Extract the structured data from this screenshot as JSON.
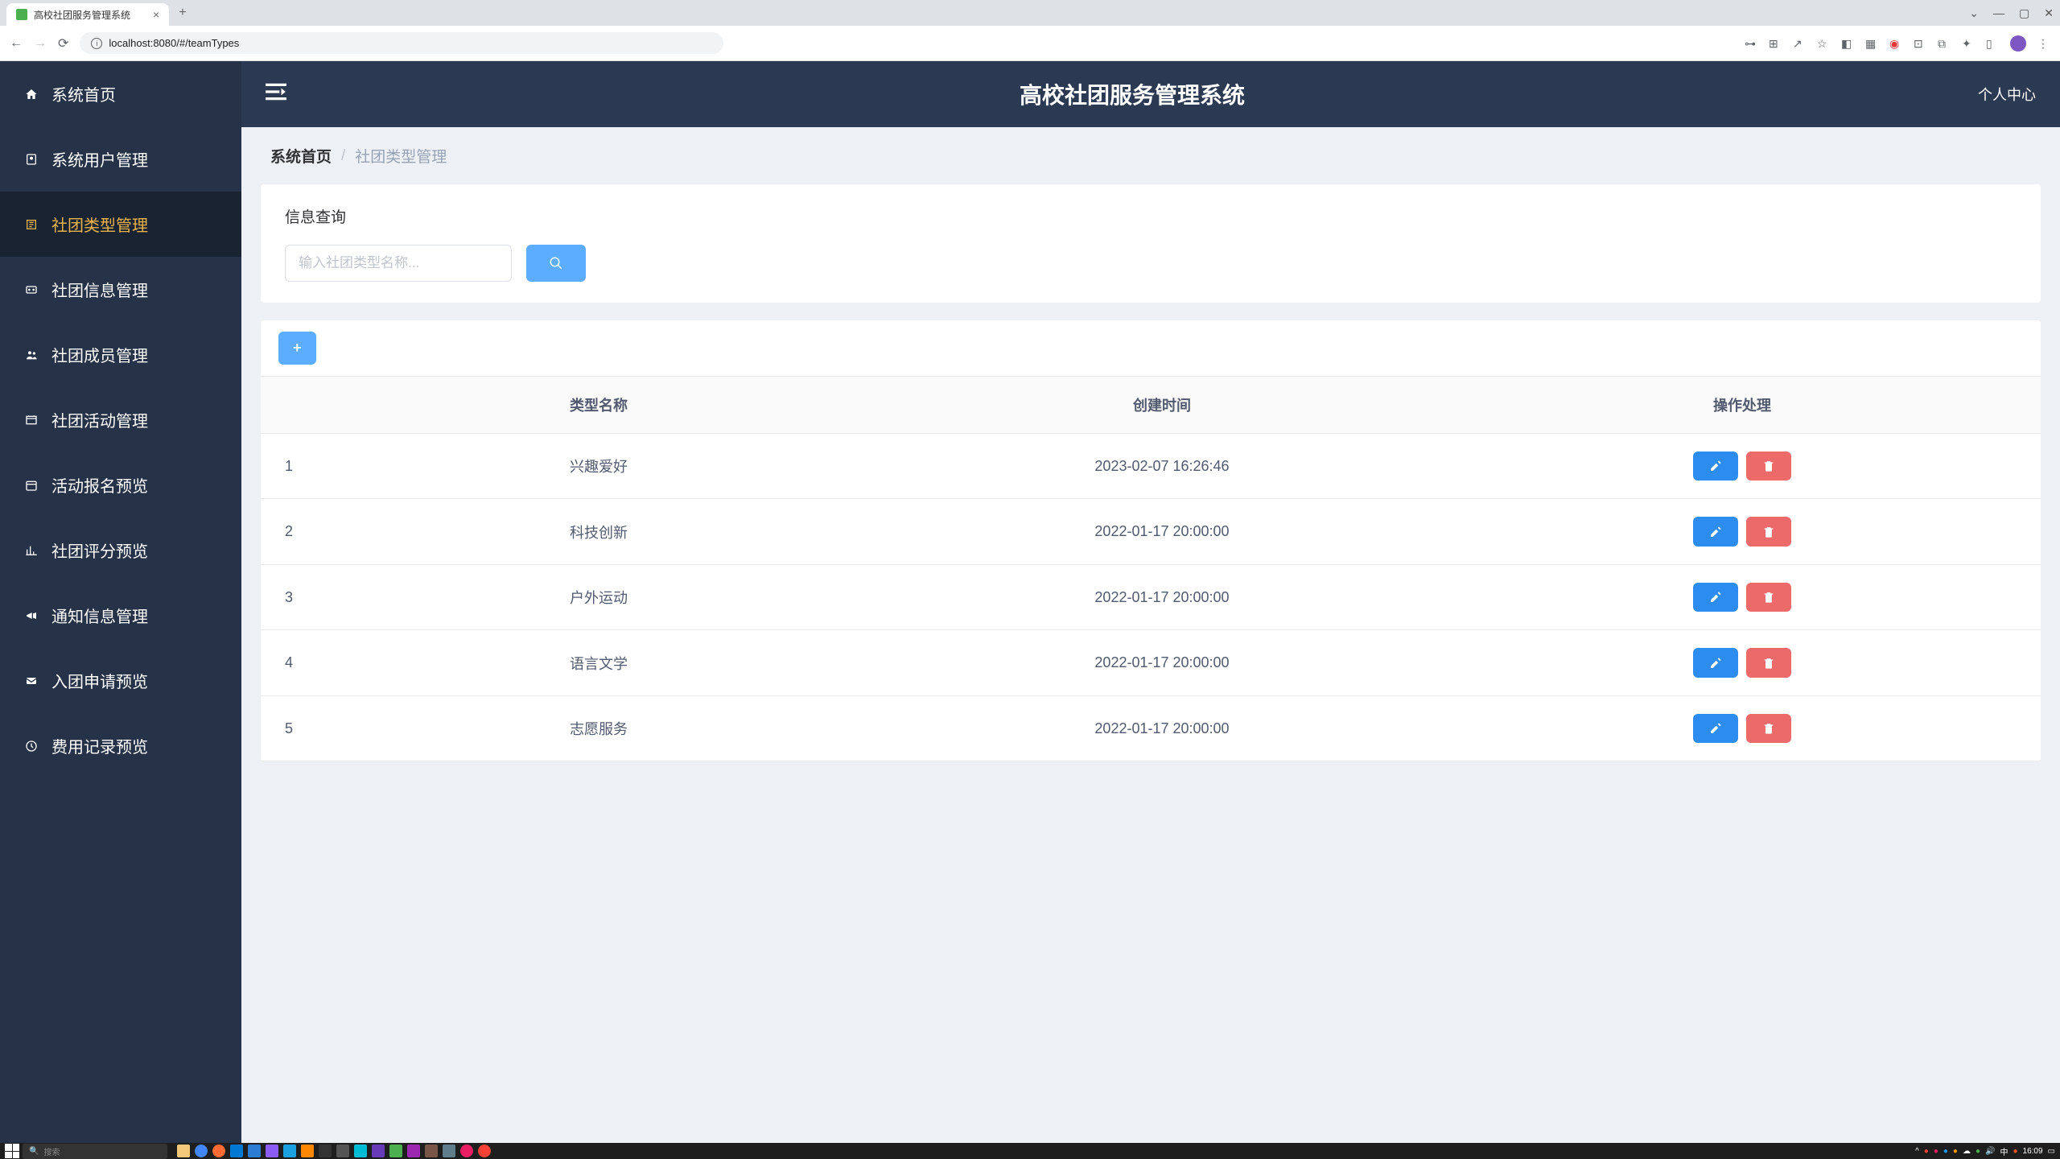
{
  "browser": {
    "tab_title": "高校社团服务管理系统",
    "url": "localhost:8080/#/teamTypes",
    "window_min": "—",
    "window_max": "▢",
    "window_close": "✕",
    "back": "←",
    "forward": "→",
    "reload": "⟳"
  },
  "sidebar": {
    "items": [
      {
        "icon": "home",
        "label": "系统首页"
      },
      {
        "icon": "user",
        "label": "系统用户管理"
      },
      {
        "icon": "tag",
        "label": "社团类型管理"
      },
      {
        "icon": "group",
        "label": "社团信息管理"
      },
      {
        "icon": "members",
        "label": "社团成员管理"
      },
      {
        "icon": "activity",
        "label": "社团活动管理"
      },
      {
        "icon": "calendar",
        "label": "活动报名预览"
      },
      {
        "icon": "chart",
        "label": "社团评分预览"
      },
      {
        "icon": "bell",
        "label": "通知信息管理"
      },
      {
        "icon": "mail",
        "label": "入团申请预览"
      },
      {
        "icon": "money",
        "label": "费用记录预览"
      }
    ]
  },
  "topbar": {
    "app_title": "高校社团服务管理系统",
    "user_center": "个人中心"
  },
  "breadcrumb": {
    "home": "系统首页",
    "sep": "/",
    "current": "社团类型管理"
  },
  "search": {
    "section_title": "信息查询",
    "placeholder": "输入社团类型名称..."
  },
  "table": {
    "headers": {
      "num": "",
      "name": "类型名称",
      "created": "创建时间",
      "actions": "操作处理"
    },
    "rows": [
      {
        "num": "1",
        "name": "兴趣爱好",
        "created": "2023-02-07 16:26:46"
      },
      {
        "num": "2",
        "name": "科技创新",
        "created": "2022-01-17 20:00:00"
      },
      {
        "num": "3",
        "name": "户外运动",
        "created": "2022-01-17 20:00:00"
      },
      {
        "num": "4",
        "name": "语言文学",
        "created": "2022-01-17 20:00:00"
      },
      {
        "num": "5",
        "name": "志愿服务",
        "created": "2022-01-17 20:00:00"
      }
    ]
  },
  "taskbar": {
    "search_placeholder": "搜索",
    "time": "16:09"
  }
}
